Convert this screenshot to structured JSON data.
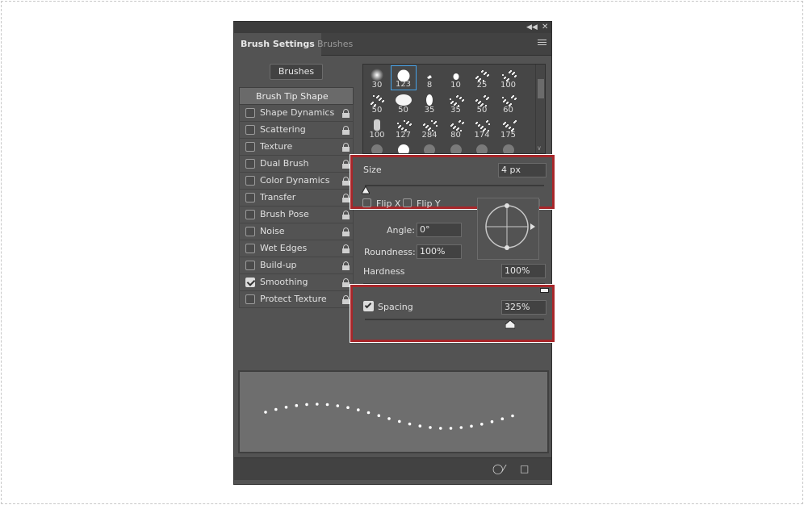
{
  "tabs": [
    {
      "label": "Brush Settings",
      "active": true
    },
    {
      "label": "Brushes",
      "active": false
    }
  ],
  "brushes_button": "Brushes",
  "list_header": "Brush Tip Shape",
  "options": [
    {
      "label": "Shape Dynamics",
      "checked": false
    },
    {
      "label": "Scattering",
      "checked": false
    },
    {
      "label": "Texture",
      "checked": false
    },
    {
      "label": "Dual Brush",
      "checked": false
    },
    {
      "label": "Color Dynamics",
      "checked": false
    },
    {
      "label": "Transfer",
      "checked": false
    },
    {
      "label": "Brush Pose",
      "checked": false
    },
    {
      "label": "Noise",
      "checked": false
    },
    {
      "label": "Wet Edges",
      "checked": false
    },
    {
      "label": "Build-up",
      "checked": false
    },
    {
      "label": "Smoothing",
      "checked": true
    },
    {
      "label": "Protect Texture",
      "checked": false
    }
  ],
  "brush_grid": [
    [
      "30",
      "123",
      "8",
      "10",
      "25",
      "100"
    ],
    [
      "50",
      "50",
      "35",
      "35",
      "50",
      "60"
    ],
    [
      "100",
      "127",
      "284",
      "80",
      "174",
      "175"
    ]
  ],
  "selected_brush": "123",
  "size": {
    "label": "Size",
    "value": "4 px",
    "slider_fraction": 0.0
  },
  "flip_x": "Flip X",
  "flip_y": "Flip Y",
  "angle": {
    "label": "Angle:",
    "value": "0°"
  },
  "roundness": {
    "label": "Roundness:",
    "value": "100%"
  },
  "hardness": {
    "label": "Hardness",
    "value": "100%",
    "slider_fraction": 1.0
  },
  "spacing": {
    "label": "Spacing",
    "value": "325%",
    "checked": true,
    "slider_fraction": 0.81
  },
  "colors": {
    "highlight": "#a8262a",
    "panel": "#535353",
    "selection": "#46a2e8"
  }
}
